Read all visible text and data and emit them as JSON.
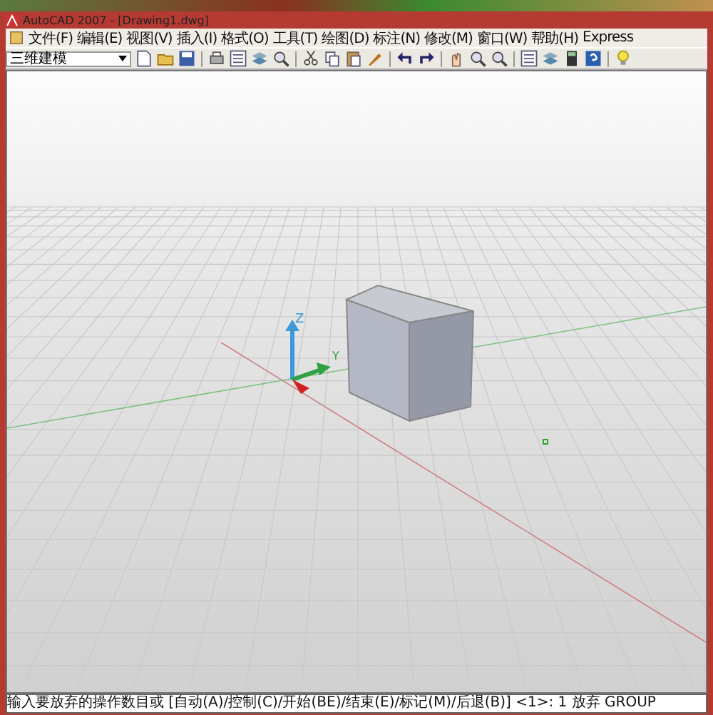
{
  "window": {
    "title": "AutoCAD 2007 - [Drawing1.dwg]"
  },
  "menu": [
    "文件(F)",
    "编辑(E)",
    "视图(V)",
    "插入(I)",
    "格式(O)",
    "工具(T)",
    "绘图(D)",
    "标注(N)",
    "修改(M)",
    "窗口(W)",
    "帮助(H)",
    "Express"
  ],
  "toolbar": {
    "workspace": "三维建模"
  },
  "viewport": {
    "ucs_labels": [
      "Z",
      "Y"
    ]
  },
  "command_line": "输入要放弃的操作数目或 [自动(A)/控制(C)/开始(BE)/结束(E)/标记(M)/后退(B)] <1>: 1 放弃 GROUP"
}
